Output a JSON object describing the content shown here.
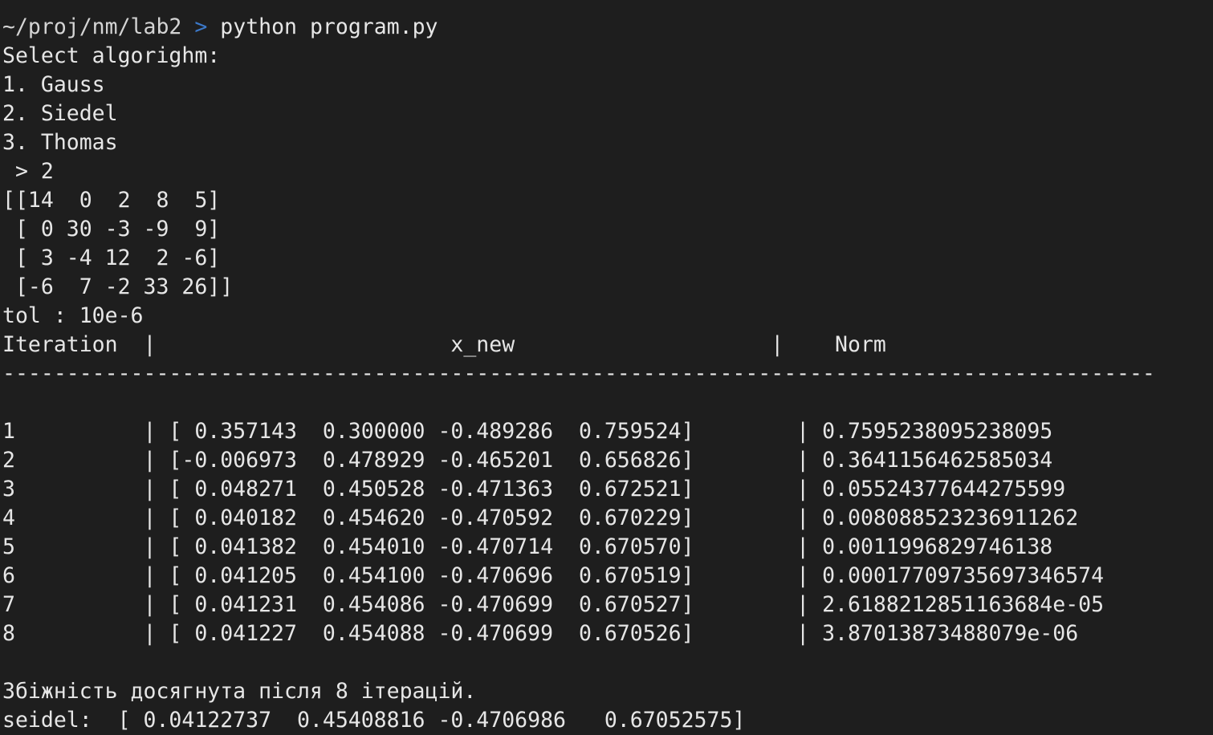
{
  "prompt": {
    "path": "~/proj/nm/lab2",
    "arrow": ">",
    "command": "python program.py"
  },
  "menu": {
    "title": "Select algorighm:",
    "options": [
      "1. Gauss",
      "2. Siedel",
      "3. Thomas"
    ],
    "input_line": " > 2"
  },
  "matrix_lines": [
    "[[14  0  2  8  5]",
    " [ 0 30 -3 -9  9]",
    " [ 3 -4 12  2 -6]",
    " [-6  7 -2 33 26]]"
  ],
  "tol_line": "tol : 10e-6",
  "table": {
    "header_line": "Iteration  |                       x_new                    |    Norm",
    "separator": "------------------------------------------------------------------------------------------",
    "rows": [
      "1          | [ 0.357143  0.300000 -0.489286  0.759524]        | 0.7595238095238095",
      "2          | [-0.006973  0.478929 -0.465201  0.656826]        | 0.3641156462585034",
      "3          | [ 0.048271  0.450528 -0.471363  0.672521]        | 0.05524377644275599",
      "4          | [ 0.040182  0.454620 -0.470592  0.670229]        | 0.008088523236911262",
      "5          | [ 0.041382  0.454010 -0.470714  0.670570]        | 0.0011996829746138",
      "6          | [ 0.041205  0.454100 -0.470696  0.670519]        | 0.00017709735697346574",
      "7          | [ 0.041231  0.454086 -0.470699  0.670527]        | 2.6188212851163684e-05",
      "8          | [ 0.041227  0.454088 -0.470699  0.670526]        | 3.87013873488079e-06"
    ]
  },
  "result": {
    "convergence_message": "Збіжність досягнута після 8 ітерацій.",
    "seidel_line": "seidel:  [ 0.04122737  0.45408816 -0.4706986   0.67052575]"
  }
}
